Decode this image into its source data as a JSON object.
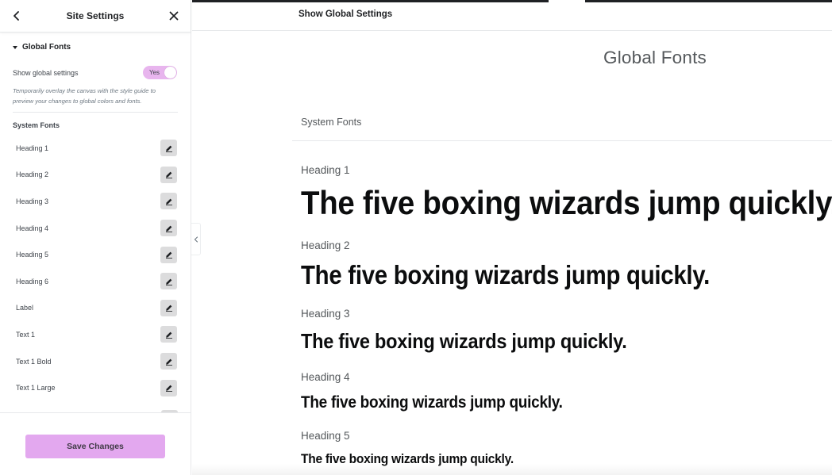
{
  "panel": {
    "title": "Site Settings",
    "section_title": "Global Fonts",
    "toggle": {
      "label": "Show global settings",
      "value": "Yes"
    },
    "help_text": "Temporarily overlay the canvas with the style guide to preview your changes to global colors and fonts.",
    "system_fonts_title": "System Fonts",
    "fonts": [
      {
        "name": "Heading 1"
      },
      {
        "name": "Heading 2"
      },
      {
        "name": "Heading 3"
      },
      {
        "name": "Heading 4"
      },
      {
        "name": "Heading 5"
      },
      {
        "name": "Heading 6"
      },
      {
        "name": "Label"
      },
      {
        "name": "Text 1"
      },
      {
        "name": "Text 1 Bold"
      },
      {
        "name": "Text 1 Large"
      }
    ],
    "save_label": "Save Changes"
  },
  "preview": {
    "topbar_title": "Show Global Settings",
    "title": "Global Fonts",
    "system_fonts_title": "System Fonts",
    "samples": [
      {
        "label": "Heading 1",
        "text": "The five boxing wizards jump quickly."
      },
      {
        "label": "Heading 2",
        "text": "The five boxing wizards jump quickly."
      },
      {
        "label": "Heading 3",
        "text": "The five boxing wizards jump quickly."
      },
      {
        "label": "Heading 4",
        "text": "The five boxing wizards jump quickly."
      },
      {
        "label": "Heading 5",
        "text": "The five boxing wizards jump quickly."
      }
    ]
  },
  "icons": {
    "back": "chevron-left-icon",
    "close": "close-icon",
    "caret": "caret-down-icon",
    "edit": "pencil-icon",
    "collapse": "chevron-left-icon"
  },
  "colors": {
    "accent": "#e3a8ef",
    "toggle_on": "#e8b5ee",
    "edit_button": "#dcdcdd"
  }
}
